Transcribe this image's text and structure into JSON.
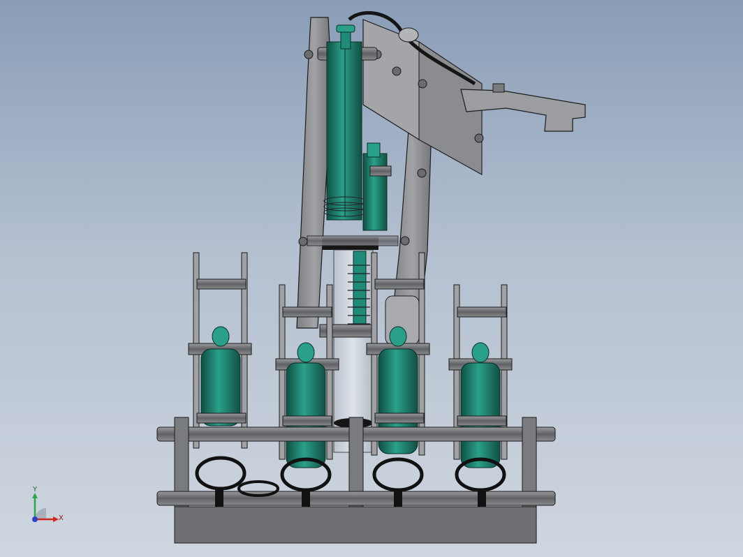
{
  "viewport": {
    "background_top": "#8a9db7",
    "background_bottom": "#cfd6df"
  },
  "model": {
    "frame_color": "#8e8f92",
    "frame_dark": "#5a5b5e",
    "rod_color": "#6e7074",
    "cylinder_color": "#1f8a78",
    "cylinder_dark": "#125446",
    "edge_color": "#1b1b1b",
    "bottle_count": 4
  },
  "triad": {
    "y_label": "Y",
    "x_label": "X",
    "y_color": "#2aa84a",
    "x_color": "#d02525",
    "z_color": "#2a40c8"
  }
}
